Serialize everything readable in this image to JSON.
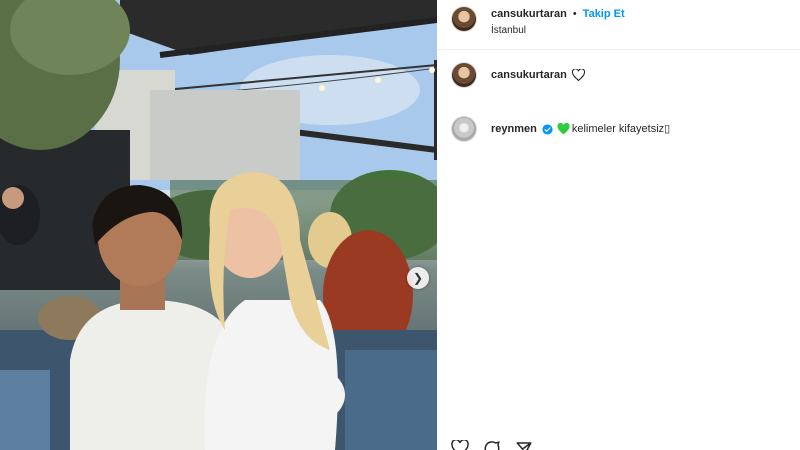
{
  "post": {
    "author": "cansukurtaran",
    "separator": "•",
    "follow_label": "Takip Et",
    "location": "İstanbul"
  },
  "comments": [
    {
      "username": "cansukurtaran",
      "text": "",
      "has_like": true
    },
    {
      "username": "reynmen",
      "verified": true,
      "text": "kelimeler kifayetsiz▯"
    }
  ],
  "icons": {
    "like": "heart-icon",
    "verified": "verified-badge-icon",
    "emoji": "green-heart-icon",
    "next": "chevron-right-icon",
    "comment": "comment-icon",
    "share": "share-icon"
  },
  "colors": {
    "follow": "#0095f6",
    "verified": "#0095f6",
    "emoji_heart": "#2ecc40"
  }
}
